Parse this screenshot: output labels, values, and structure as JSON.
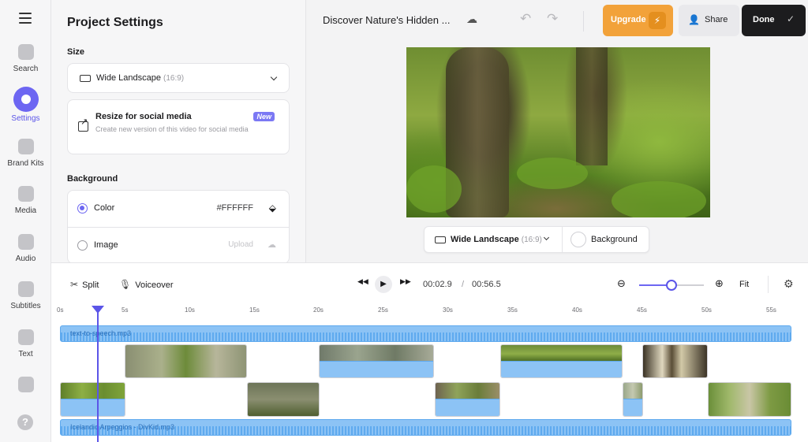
{
  "rail": {
    "items": [
      {
        "label": "Search",
        "icon": "search-icon"
      },
      {
        "label": "Settings",
        "icon": "settings-icon",
        "active": true
      },
      {
        "label": "Brand Kits",
        "icon": "brand-kit-icon"
      },
      {
        "label": "Media",
        "icon": "media-icon"
      },
      {
        "label": "Audio",
        "icon": "audio-icon"
      },
      {
        "label": "Subtitles",
        "icon": "subtitles-icon"
      },
      {
        "label": "Text",
        "icon": "text-icon"
      }
    ],
    "help": "?"
  },
  "panel": {
    "title": "Project Settings",
    "size_heading": "Size",
    "size_value": "Wide Landscape",
    "size_ratio": "(16:9)",
    "resize_title": "Resize for social media",
    "resize_desc": "Create new version of this video for social media",
    "resize_badge": "New",
    "background_heading": "Background",
    "bg_color_label": "Color",
    "bg_color_value": "#FFFFFF",
    "bg_image_label": "Image",
    "bg_image_upload": "Upload"
  },
  "topbar": {
    "title": "Discover Nature's Hidden ...",
    "upgrade": "Upgrade",
    "share": "Share",
    "done": "Done"
  },
  "canvas": {
    "size_value": "Wide Landscape",
    "size_ratio": "(16:9)",
    "background": "Background"
  },
  "timeline": {
    "split": "Split",
    "voiceover": "Voiceover",
    "current_time": "00:02.9",
    "separator": "/",
    "total_time": "00:56.5",
    "fit": "Fit",
    "zoom_level": 0.5,
    "ticks": [
      "0s",
      "5s",
      "10s",
      "15s",
      "20s",
      "25s",
      "30s",
      "35s",
      "40s",
      "45s",
      "50s",
      "55s"
    ],
    "tts_track": "text-to-speech.mp3",
    "music_track": "Icelandic Arpeggios - DivKid.mp3"
  },
  "colors": {
    "accent": "#6d66f2",
    "upgrade": "#f2a23a",
    "done": "#1c1c1e",
    "audio": "#8cc3f5"
  }
}
